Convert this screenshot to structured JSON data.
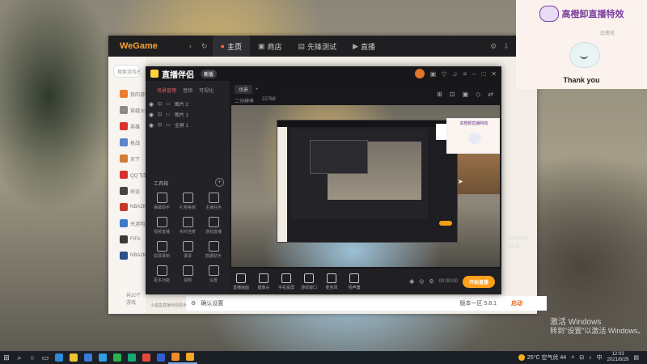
{
  "wallpaper": {
    "activate_line1": "激活 Windows",
    "activate_line2": "转到\"设置\"以激活 Windows。"
  },
  "wegame": {
    "logo": "WeGame",
    "tabs": [
      {
        "label": "主页",
        "active": true
      },
      {
        "label": "商店",
        "active": false
      },
      {
        "label": "先锋测试",
        "active": false
      },
      {
        "label": "直播",
        "active": false
      }
    ],
    "search_placeholder": "搜索游戏名",
    "games": [
      {
        "label": "我的游戏",
        "color": "#f07b2e"
      },
      {
        "label": "穿越火线",
        "color": "#8b8b8b"
      },
      {
        "label": "英雄",
        "color": "#d7342c"
      },
      {
        "label": "枪战",
        "color": "#5c86c7"
      },
      {
        "label": "天下",
        "color": "#d27d34"
      },
      {
        "label": "QQ飞车",
        "color": "#d73232"
      },
      {
        "label": "命运",
        "color": "#444444"
      },
      {
        "label": "NBA2K",
        "color": "#c43a2a"
      },
      {
        "label": "天涯明月刀",
        "color": "#3c7ac9"
      },
      {
        "label": "FIFA",
        "color": "#3a3a3a"
      },
      {
        "label": "NBA2K",
        "color": "#2b4f86"
      }
    ],
    "footer": "共10个游戏",
    "status_text": "确认设置",
    "version": "版本一区 5.8.1",
    "launch_label": "启动"
  },
  "zhibo": {
    "logo": "直播伴侣",
    "badge": "新版",
    "left_tabs": [
      "场景管理",
      "音频",
      "可视化"
    ],
    "layers": [
      "图片 2",
      "图片 1",
      "全屏 1"
    ],
    "tools_title": "工具箱",
    "tools": [
      "弹幕助手",
      "礼物答谢",
      "主播任务",
      "视频直播",
      "实时连麦",
      "游戏直播",
      "投屏录制",
      "录屏",
      "数据助手",
      "更多功能",
      "视频",
      "设置"
    ],
    "warning": "小黑盒直播伴侣助手",
    "scene_tab": "场景",
    "resolution": "二分辨率",
    "bitrate": "22768",
    "bottom_buttons": [
      "直播画面",
      "摄像头",
      "手机投屏",
      "游戏窗口",
      "麦克风",
      "扬声器"
    ],
    "timer": "00:00:00",
    "live_button": "开始直播"
  },
  "widget": {
    "header": "高橙卸直播特效",
    "footer": "Thank you",
    "tag": "白莲花"
  },
  "side_labels": [
    "系统消息声音",
    "弹幕信息"
  ],
  "taskbar": {
    "weather": "25°C 空气优 44",
    "time": "12:03",
    "date": "2021/8/29",
    "apps": [
      {
        "name": "edge",
        "color": "#2e8ad8"
      },
      {
        "name": "explorer",
        "color": "#f1c232"
      },
      {
        "name": "store",
        "color": "#3a7bd5"
      },
      {
        "name": "mail",
        "color": "#2f9ee6"
      },
      {
        "name": "wechat",
        "color": "#2bb24c"
      },
      {
        "name": "player",
        "color": "#19a974"
      },
      {
        "name": "chrome",
        "color": "#e44a3c"
      },
      {
        "name": "app",
        "color": "#2f5fd0"
      },
      {
        "name": "wegame",
        "color": "#f18b2b"
      },
      {
        "name": "zhibo",
        "color": "#f5a623"
      }
    ]
  }
}
